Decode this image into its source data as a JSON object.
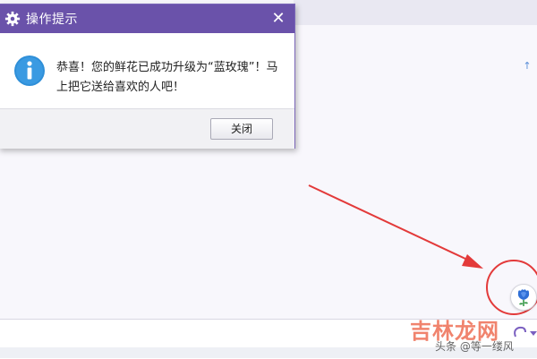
{
  "dialog": {
    "title": "操作提示",
    "message": "恭喜！您的鲜花已成功升级为“蓝玫瑰”！马上把它送给喜欢的人吧！",
    "close_button_label": "关闭",
    "close_glyph": "✕",
    "icons": {
      "title": "gear-icon",
      "message": "info-icon",
      "close": "close-icon"
    }
  },
  "chat": {
    "scroll_up_glyph": "↑",
    "flower_button_icon": "blue-rose-icon"
  },
  "annotation": {
    "arrow_color": "#e33a3a",
    "highlight_circle_color": "#e33a3a"
  },
  "watermark": {
    "logo_text": "吉林龙网",
    "credit_text": "头条 @等一缕风"
  },
  "colors": {
    "titlebar": "#6a52aa",
    "info_icon": "#2f8fd8",
    "accent_purple": "#7a5fc0"
  }
}
